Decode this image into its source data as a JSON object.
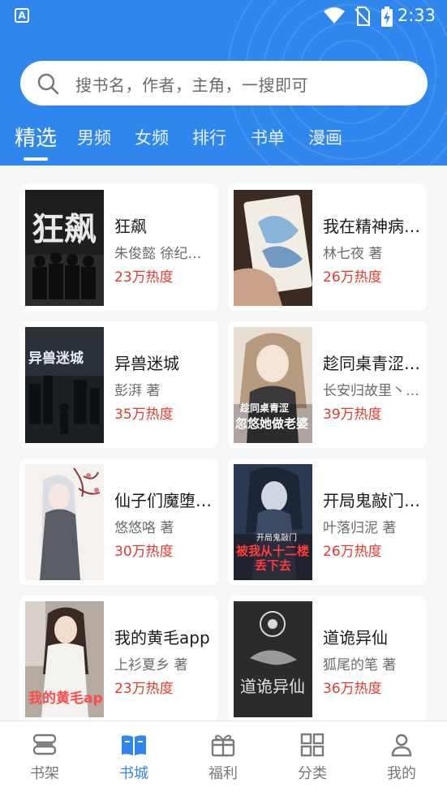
{
  "status": {
    "time": "2:33"
  },
  "search": {
    "placeholder": "搜书名，作者，主角，一搜即可"
  },
  "tabs": [
    {
      "label": "精选",
      "active": true
    },
    {
      "label": "男频"
    },
    {
      "label": "女频"
    },
    {
      "label": "排行"
    },
    {
      "label": "书单"
    },
    {
      "label": "漫画"
    }
  ],
  "books": [
    {
      "title": "狂飙",
      "author": "朱俊懿 徐纪周 著",
      "heat": "23万热度",
      "cover_icon": "dark-crowd-cover"
    },
    {
      "title": "我在精神病院学斩神",
      "author": "林七夜 著",
      "heat": "26万热度",
      "cover_icon": "painted-hand-cover"
    },
    {
      "title": "异兽迷城",
      "author": "彭湃 著",
      "heat": "35万热度",
      "cover_icon": "dark-city-cover"
    },
    {
      "title": "趁同桌青涩，忽悠她做老婆",
      "author": "长安归故里丶 著",
      "heat": "39万热度",
      "cover_icon": "anime-girl-cover"
    },
    {
      "title": "仙子们魔堕了？与我何干",
      "author": "悠悠咯 著",
      "heat": "30万热度",
      "cover_icon": "white-hair-girl-cover"
    },
    {
      "title": "开局鬼敲门：被我从十二楼丢下去",
      "author": "叶落归泥 著",
      "heat": "26万热度",
      "cover_icon": "ghost-girl-cover"
    },
    {
      "title": "我的黄毛app",
      "author": "上衫夏乡 著",
      "heat": "23万热度",
      "cover_icon": "office-girl-cover"
    },
    {
      "title": "道诡异仙",
      "author": "狐尾的笔 著",
      "heat": "36万热度",
      "cover_icon": "ink-hand-cover"
    }
  ],
  "cover_text": {
    "book0": "狂飙",
    "book2": "异兽迷城",
    "book3_line1": "趁同桌青涩",
    "book3_line2": "忽悠她做老婆",
    "book5_line1": "开局鬼敲门",
    "book5_line2": "被我从十二楼",
    "book5_line3": "丢下去",
    "book6": "我的黄毛app",
    "book7": "道诡异仙"
  },
  "bottom_nav": [
    {
      "label": "书架",
      "icon": "bookshelf-icon"
    },
    {
      "label": "书城",
      "icon": "open-book-icon",
      "active": true
    },
    {
      "label": "福利",
      "icon": "gift-icon"
    },
    {
      "label": "分类",
      "icon": "grid-icon"
    },
    {
      "label": "我的",
      "icon": "person-icon"
    }
  ],
  "colors": {
    "brand": "#2f86ec",
    "heat": "#e23b2e"
  }
}
